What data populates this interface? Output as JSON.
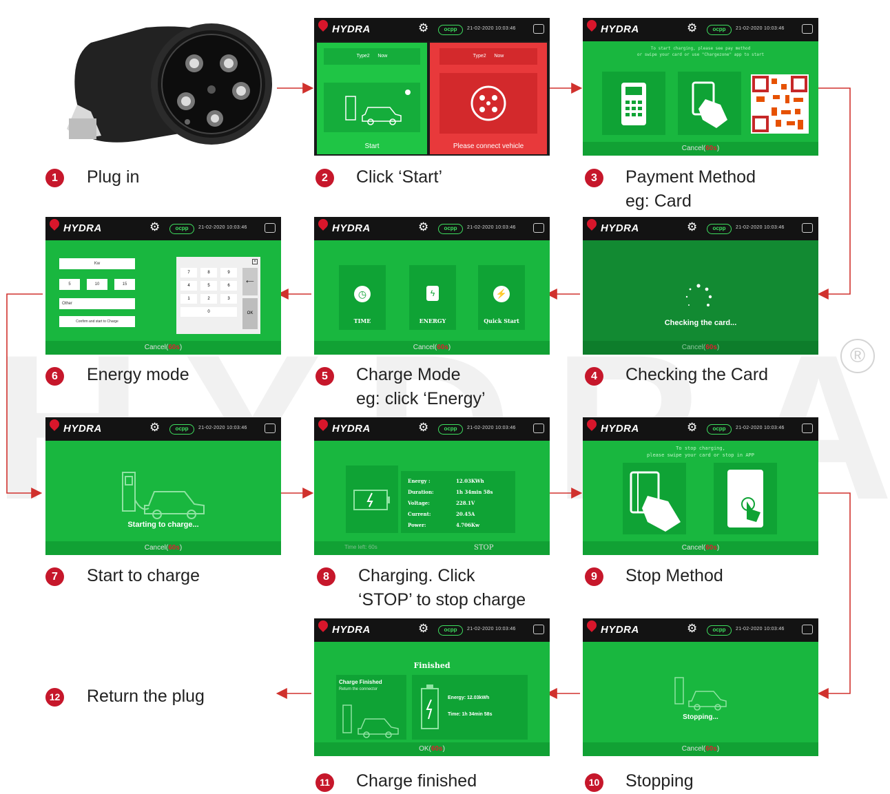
{
  "common": {
    "brand": "HYDRA",
    "status_badge": "ocpp",
    "datetime": "21-02-2020 10:03:46",
    "cancel_text": "Cancel(",
    "countdown": "60s",
    "cancel_close": ")"
  },
  "steps": {
    "s1": {
      "num": "1",
      "caption": "Plug in"
    },
    "s2": {
      "num": "2",
      "caption": "Click ‘Start’",
      "left_label": "Start",
      "right_label": "Please connect vehicle",
      "type_label": "Type2",
      "power_label": "Now"
    },
    "s3": {
      "num": "3",
      "caption": "Payment Method\neg: Card",
      "instruction": "To start charging, please see pay method\nor swipe your card or use \"Chargezone\" app to start"
    },
    "s4": {
      "num": "4",
      "caption": "Checking the Card",
      "message": "Checking the card..."
    },
    "s5": {
      "num": "5",
      "caption": "Charge Mode\neg: click ‘Energy’",
      "modes": [
        "TIME",
        "ENERGY",
        "Quick Start"
      ]
    },
    "s6": {
      "num": "6",
      "caption": "Energy mode",
      "field": "Kw",
      "presets": [
        "5",
        "10",
        "15"
      ],
      "other": "Other",
      "confirm": "Confirm and start to Charge",
      "keys": [
        "7",
        "8",
        "9",
        "4",
        "5",
        "6",
        "1",
        "2",
        "3",
        "0"
      ],
      "ok": "OK"
    },
    "s7": {
      "num": "7",
      "caption": "Start to charge",
      "message": "Starting to charge..."
    },
    "s8": {
      "num": "8",
      "caption": "Charging. Click\n‘STOP’ to stop charge",
      "metrics": [
        {
          "label": "Energy :",
          "value": "12.03KWh"
        },
        {
          "label": "Duration:",
          "value": "1h 34min 58s"
        },
        {
          "label": "Voltage:",
          "value": "228.1V"
        },
        {
          "label": "Current:",
          "value": "20.45A"
        },
        {
          "label": "Power:",
          "value": "4.706Kw"
        }
      ],
      "stop": "STOP",
      "time_left": "Time left: 60s"
    },
    "s9": {
      "num": "9",
      "caption": "Stop Method",
      "instruction": "To stop charging,\nplease swipe your card or stop in APP"
    },
    "s10": {
      "num": "10",
      "caption": "Stopping",
      "message": "Stopping..."
    },
    "s11": {
      "num": "11",
      "caption": "Charge finished",
      "title": "Finished",
      "panel_title": "Charge Finished",
      "panel_sub": "Return the connector",
      "energy": "Energy: 12.03kWh",
      "time": "Time: 1h 34min 58s",
      "ok": "OK(",
      "countdown": "60s"
    },
    "s12": {
      "num": "12",
      "caption": "Return the plug"
    }
  },
  "colors": {
    "screen_green": "#19b73f",
    "dark_green": "#0fa335",
    "header": "#131313",
    "accent_red": "#c6172b",
    "arrow_red": "#d0312d"
  }
}
